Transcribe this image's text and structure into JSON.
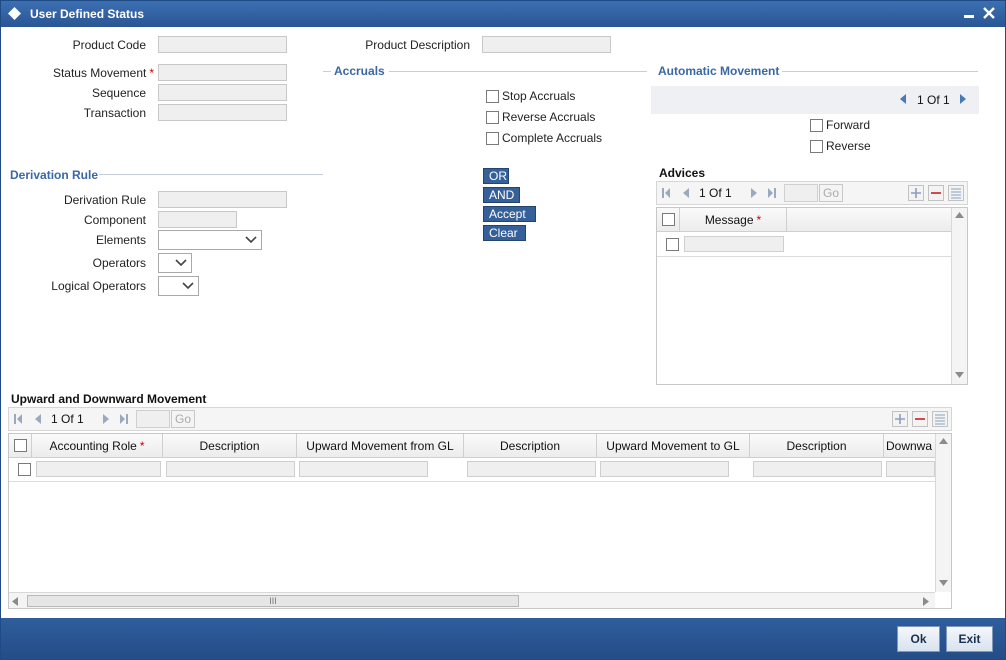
{
  "window": {
    "title": "User Defined Status"
  },
  "header": {
    "product_code_label": "Product Code",
    "product_description_label": "Product Description",
    "status_movement_label": "Status Movement",
    "sequence_label": "Sequence",
    "transaction_label": "Transaction",
    "required_mark": "*"
  },
  "accruals": {
    "title": "Accruals",
    "stop_label": "Stop Accruals",
    "reverse_label": "Reverse Accruals",
    "complete_label": "Complete Accruals"
  },
  "automatic_movement": {
    "title": "Automatic Movement",
    "pager": "1 Of 1",
    "forward_label": "Forward",
    "reverse_label": "Reverse"
  },
  "derivation": {
    "title": "Derivation Rule",
    "rule_label": "Derivation Rule",
    "component_label": "Component",
    "elements_label": "Elements",
    "operators_label": "Operators",
    "logical_operators_label": "Logical Operators"
  },
  "rule_buttons": {
    "or": "OR",
    "and": "AND",
    "accept": "Accept",
    "clear": "Clear"
  },
  "advices": {
    "title": "Advices",
    "pager": "1 Of 1",
    "go": "Go",
    "columns": [
      "Message"
    ]
  },
  "movement": {
    "title": "Upward and Downward Movement",
    "pager": "1 Of 1",
    "go": "Go",
    "columns": [
      "Accounting Role",
      "Description",
      "Upward Movement from GL",
      "Description",
      "Upward Movement to GL",
      "Description",
      "Downwa"
    ],
    "scroll_grip": "III"
  },
  "footer": {
    "ok": "Ok",
    "exit": "Exit"
  }
}
